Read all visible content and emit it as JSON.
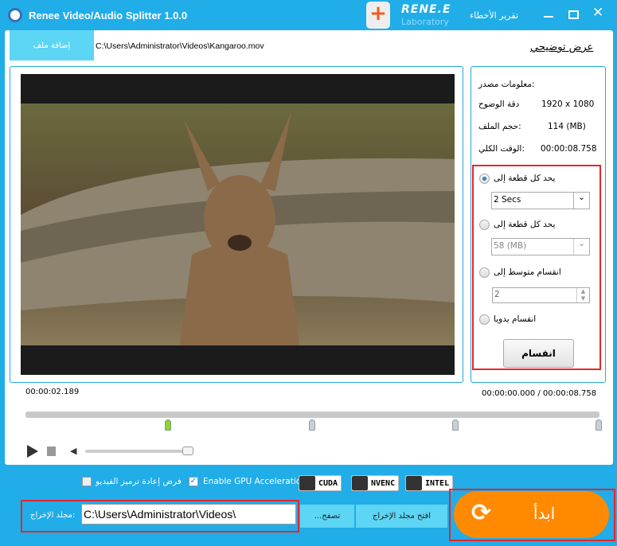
{
  "app": {
    "title": "Renee Video/Audio Splitter 1.0.0",
    "logo_top": "RENE.E",
    "logo_bottom": "Laboratory",
    "report": "تقرير الأخطاء"
  },
  "top": {
    "add_file": "إضافة ملف",
    "file_path": "C:\\Users\\Administrator\\Videos\\Kangaroo.mov",
    "demo_link": "عرض توضيحي"
  },
  "info": {
    "source_label": "معلومات مصدر:",
    "resolution_label": "دقة الوضوح",
    "resolution": "1920 x 1080",
    "size_label": "حجم الملف:",
    "size": "114 (MB)",
    "duration_label": "الوقت الكلي:",
    "duration": "00:00:08.758"
  },
  "split": {
    "by_time_label": "يحد كل قطعة إلى",
    "by_time_value": "2 Secs",
    "by_size_label": "يحد كل قطعة إلى",
    "by_size_value": "58 (MB)",
    "average_label": "انقسام متوسط إلى",
    "average_value": "2",
    "manual_label": "انقسام يدويا",
    "split_button": "انقسام",
    "selected": "by_time"
  },
  "timeline": {
    "current": "00:00:02.189",
    "range": "00:00:00.000 / 00:00:08.758",
    "volume": 0.9
  },
  "options": {
    "reencode_label": "فرض إعادة ترميز الفيديو",
    "reencode_checked": false,
    "gpu_label": "Enable GPU Acceleration",
    "gpu_checked": true,
    "cuda": "CUDA",
    "nvenc": "NVENC",
    "intel": "INTEL"
  },
  "output": {
    "label": "مجلد الإخراج:",
    "path": "C:\\Users\\Administrator\\Videos\\",
    "browse": "...تصفح",
    "open_folder": "افتح مجلد الإخراج",
    "start": "ابدأ"
  },
  "colors": {
    "window": "#20ade8",
    "start": "#ff8a00",
    "accent_red": "#e5262e"
  }
}
